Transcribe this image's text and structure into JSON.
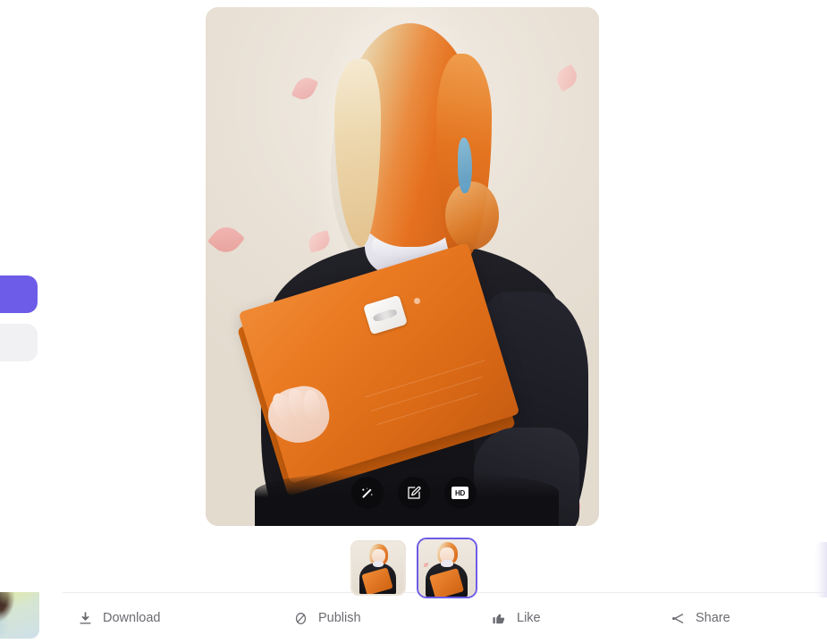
{
  "theme": {
    "accent": "#6c5ce7",
    "page_bg": "#ffffff",
    "image_bg": "#ece5da",
    "bar_text": "#6b6b72",
    "overlay_button_bg": "rgba(10,10,12,0.88)"
  },
  "left_rail": {
    "primary_button": {
      "name": "primary-action",
      "color": "#6c5ce7"
    },
    "secondary_button": {
      "name": "secondary-action",
      "color": "#f1f0f3"
    },
    "peek_thumbnail": {
      "name": "previous-generation-thumbnail"
    }
  },
  "preview": {
    "name": "generated-image-preview",
    "alt": "Anime illustration of a smiling orange-haired woman in a black sweater holding an orange folder",
    "background_color": "#ece5da"
  },
  "image_actions": [
    {
      "id": "enhance",
      "icon": "magic-wand-icon",
      "label": "Enhance"
    },
    {
      "id": "edit",
      "icon": "edit-pencil-icon",
      "label": "Edit"
    },
    {
      "id": "upscale",
      "icon": "hd-icon",
      "label": "HD"
    }
  ],
  "hd_chip_text": "HD",
  "thumbnails": [
    {
      "id": "variation-1",
      "selected": false
    },
    {
      "id": "variation-2",
      "selected": true
    }
  ],
  "bottom_bar": {
    "download": {
      "label": "Download",
      "icon": "download-icon"
    },
    "publish": {
      "label": "Publish",
      "icon": "publish-circle-slash-icon"
    },
    "like": {
      "label": "Like",
      "icon": "thumbs-up-icon"
    },
    "share": {
      "label": "Share",
      "icon": "share-icon"
    }
  }
}
